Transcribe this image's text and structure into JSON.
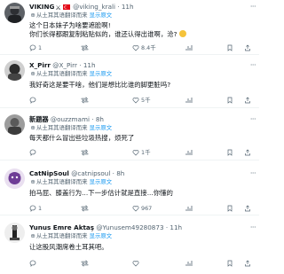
{
  "tweets": [
    {
      "name": "VIKING",
      "handle": "@viking_krali",
      "time": "11h",
      "translated_note": "从土耳其语翻译而来",
      "show_original": "显示原文",
      "text": "这个日本妹子为啥要遮脸啊!",
      "text2": "你们长得都跟复制粘贴似的，谁还认得出谁啊，沧?",
      "stats": {
        "reply": "1",
        "retweet": "",
        "like": "8.4千"
      },
      "colors": {
        "avatar": "#6b6b6b"
      }
    },
    {
      "name": "X_Pirr",
      "handle": "@X_Pirr",
      "time": "11h",
      "translated_note": "从土耳其语翻译而来",
      "show_original": "显示原文",
      "text": "我好奇这是要干啥，他们是想比比谁的脚更脏吗?",
      "text2": "",
      "stats": {
        "reply": "",
        "retweet": "",
        "like": "5千"
      },
      "colors": {
        "avatar": "#3a3a3a"
      }
    },
    {
      "name": "新题器",
      "handle": "@ouzzmami",
      "time": "8h",
      "translated_note": "从土耳其语翻译而来",
      "show_original": "显示原文",
      "text": "每天都什么冒出些垃圾热搜，烦死了",
      "text2": "",
      "stats": {
        "reply": "",
        "retweet": "",
        "like": "1千"
      },
      "colors": {
        "avatar": "#8a8a8a"
      }
    },
    {
      "name": "CatNipSoul",
      "handle": "@catnipsoul",
      "time": "8h",
      "translated_note": "从土耳其语翻译而来",
      "show_original": "显示原文",
      "text": "拍马屁、膝盖行为...下一步估计就是直接...你懂的",
      "text2": "",
      "stats": {
        "reply": "1",
        "retweet": "",
        "like": "967"
      },
      "colors": {
        "avatar": "#7b3fa0"
      }
    },
    {
      "name": "Yunus Emre Aktaş",
      "handle": "@Yunusem49280873",
      "time": "11h",
      "translated_note": "从土耳其语翻译而来",
      "show_original": "显示原文",
      "text": "让这股风潮席卷土耳其吧。",
      "text2": "",
      "stats": {
        "reply": "",
        "retweet": "",
        "like": ""
      },
      "colors": {
        "avatar": "#c2c2c2"
      }
    }
  ],
  "icons": {
    "more": "more-horizontal-icon",
    "globe": "globe-icon",
    "reply": "reply-icon",
    "retweet": "retweet-icon",
    "like": "like-icon",
    "views": "views-icon",
    "bookmark": "bookmark-icon",
    "share": "share-icon"
  },
  "colors": {
    "text": "#0f1419",
    "secondary": "#536471",
    "link": "#1d9bf0",
    "divider": "#eff3f4"
  }
}
